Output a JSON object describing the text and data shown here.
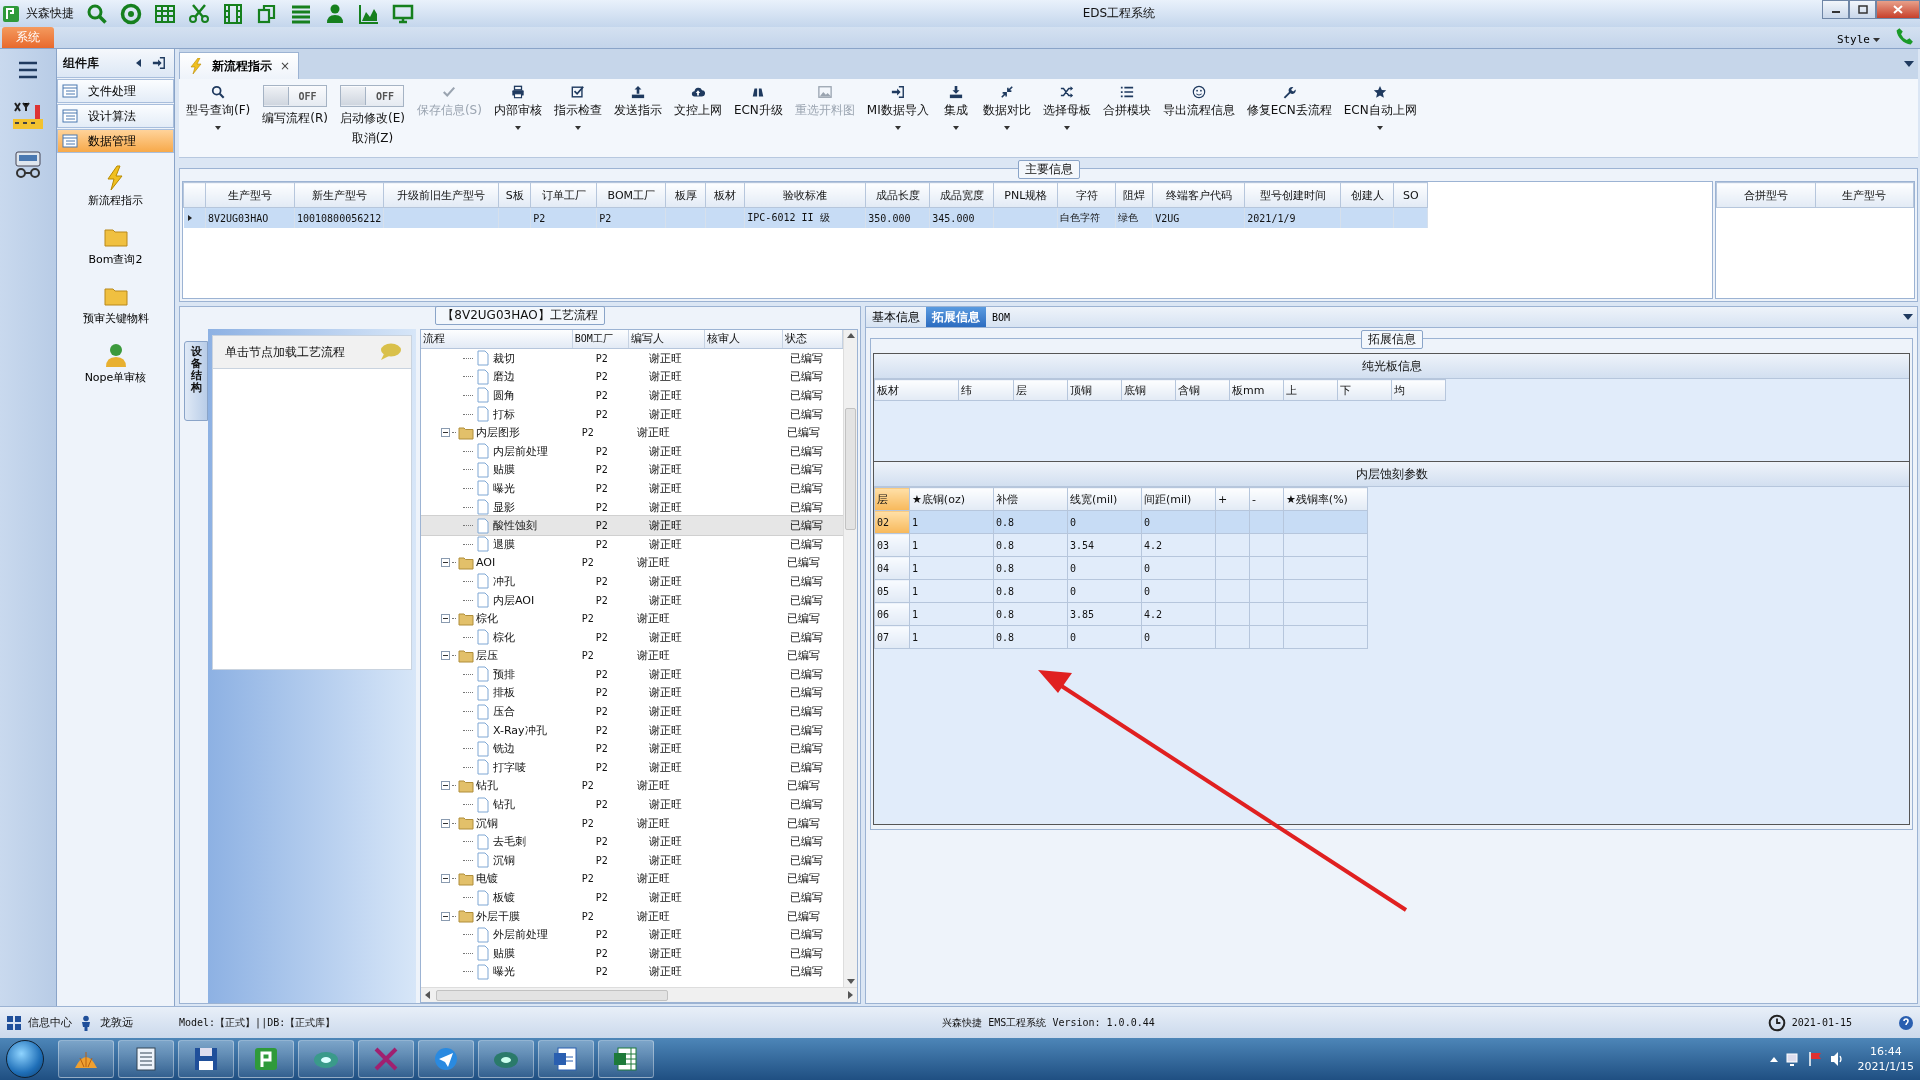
{
  "window": {
    "app_name": "兴森快捷",
    "title": "EDS工程系统"
  },
  "ribbon": {
    "tab": "系统",
    "style_menu": "Style"
  },
  "component_panel": {
    "title": "组件库",
    "items": [
      {
        "label": "文件处理",
        "selected": false
      },
      {
        "label": "设计算法",
        "selected": false
      },
      {
        "label": "数据管理",
        "selected": true
      }
    ],
    "shortcuts": [
      "新流程指示",
      "Bom查询2",
      "预审关键物料",
      "Nope单审核"
    ]
  },
  "document_tab": {
    "title": "新流程指示",
    "close": "×"
  },
  "toolbar": [
    {
      "kind": "button",
      "label": "型号查询(F)",
      "disabled": false,
      "dropdown": true
    },
    {
      "kind": "toggle",
      "label": "编写流程(R)",
      "toggle_text": "OFF",
      "on": false,
      "disabled": false,
      "dropdown": false
    },
    {
      "kind": "toggle",
      "label": "启动修改(E)",
      "sub_label": "取消(Z)",
      "toggle_text": "OFF",
      "on": false,
      "disabled": false,
      "dropdown": false
    },
    {
      "kind": "button",
      "label": "保存信息(S)",
      "disabled": true,
      "dropdown": false
    },
    {
      "kind": "button",
      "label": "内部审核",
      "disabled": false,
      "dropdown": true
    },
    {
      "kind": "button",
      "label": "指示检查",
      "disabled": false,
      "dropdown": true
    },
    {
      "kind": "button",
      "label": "发送指示",
      "disabled": false,
      "dropdown": false
    },
    {
      "kind": "button",
      "label": "文控上网",
      "disabled": false,
      "dropdown": false
    },
    {
      "kind": "button",
      "label": "ECN升级",
      "disabled": false,
      "dropdown": false
    },
    {
      "kind": "button",
      "label": "重选开料图",
      "disabled": true,
      "dropdown": false
    },
    {
      "kind": "button",
      "label": "MI数据导入",
      "disabled": false,
      "dropdown": true
    },
    {
      "kind": "button",
      "label": "集成",
      "disabled": false,
      "dropdown": true
    },
    {
      "kind": "button",
      "label": "数据对比",
      "disabled": false,
      "dropdown": true
    },
    {
      "kind": "button",
      "label": "选择母板",
      "disabled": false,
      "dropdown": true
    },
    {
      "kind": "button",
      "label": "合拼模块",
      "disabled": false,
      "dropdown": false
    },
    {
      "kind": "button",
      "label": "导出流程信息",
      "disabled": false,
      "dropdown": false
    },
    {
      "kind": "button",
      "label": "修复ECN丢流程",
      "disabled": false,
      "dropdown": false
    },
    {
      "kind": "button",
      "label": "ECN自动上网",
      "disabled": false,
      "dropdown": true
    }
  ],
  "main_info": {
    "title": "主要信息",
    "columns": [
      "生产型号",
      "新生产型号",
      "升级前旧生产型号",
      "S板",
      "订单工厂",
      "BOM工厂",
      "板厚",
      "板材",
      "验收标准",
      "成品长度",
      "成品宽度",
      "PNL规格",
      "字符",
      "阻焊",
      "终端客户代码",
      "型号创建时间",
      "创建人",
      "SO"
    ],
    "rows": [
      {
        "selected": true,
        "cells": [
          "8V2UG03HAO",
          "10010800056212",
          null,
          null,
          "P2",
          "P2",
          null,
          null,
          "IPC-6012 II 级",
          "350.000",
          "345.000",
          null,
          "白色字符",
          "绿色",
          "V2UG",
          "2021/1/9",
          null,
          null
        ]
      }
    ],
    "merge_columns": [
      "合拼型号",
      "生产型号"
    ]
  },
  "process_tree": {
    "title": "【8V2UG03HAO】工艺流程",
    "side_tab": "设备结构",
    "hint": "单击节点加载工艺流程",
    "columns": [
      "流程",
      "BOM工厂",
      "编写人",
      "核审人",
      "状态"
    ],
    "nodes": [
      {
        "kind": "step",
        "name": "裁切",
        "bom": "P2",
        "author": "谢正旺",
        "status": "已编写",
        "selected": false
      },
      {
        "kind": "step",
        "name": "磨边",
        "bom": "P2",
        "author": "谢正旺",
        "status": "已编写",
        "selected": false
      },
      {
        "kind": "step",
        "name": "圆角",
        "bom": "P2",
        "author": "谢正旺",
        "status": "已编写",
        "selected": false
      },
      {
        "kind": "step",
        "name": "打标",
        "bom": "P2",
        "author": "谢正旺",
        "status": "已编写",
        "selected": false
      },
      {
        "kind": "folder",
        "name": "内层图形",
        "bom": "P2",
        "author": "谢正旺",
        "status": "已编写",
        "selected": false,
        "expanded": true,
        "children": [
          {
            "kind": "step",
            "name": "内层前处理",
            "bom": "P2",
            "author": "谢正旺",
            "status": "已编写",
            "selected": false
          },
          {
            "kind": "step",
            "name": "贴膜",
            "bom": "P2",
            "author": "谢正旺",
            "status": "已编写",
            "selected": false
          },
          {
            "kind": "step",
            "name": "曝光",
            "bom": "P2",
            "author": "谢正旺",
            "status": "已编写",
            "selected": false
          },
          {
            "kind": "step",
            "name": "显影",
            "bom": "P2",
            "author": "谢正旺",
            "status": "已编写",
            "selected": false
          },
          {
            "kind": "step",
            "name": "酸性蚀刻",
            "bom": "P2",
            "author": "谢正旺",
            "status": "已编写",
            "selected": true
          },
          {
            "kind": "step",
            "name": "退膜",
            "bom": "P2",
            "author": "谢正旺",
            "status": "已编写",
            "selected": false
          }
        ]
      },
      {
        "kind": "folder",
        "name": "AOI",
        "bom": "P2",
        "author": "谢正旺",
        "status": "已编写",
        "selected": false,
        "expanded": true,
        "children": [
          {
            "kind": "step",
            "name": "冲孔",
            "bom": "P2",
            "author": "谢正旺",
            "status": "已编写",
            "selected": false
          },
          {
            "kind": "step",
            "name": "内层AOI",
            "bom": "P2",
            "author": "谢正旺",
            "status": "已编写",
            "selected": false
          }
        ]
      },
      {
        "kind": "folder",
        "name": "棕化",
        "bom": "P2",
        "author": "谢正旺",
        "status": "已编写",
        "selected": false,
        "expanded": true,
        "children": [
          {
            "kind": "step",
            "name": "棕化",
            "bom": "P2",
            "author": "谢正旺",
            "status": "已编写",
            "selected": false
          }
        ]
      },
      {
        "kind": "folder",
        "name": "层压",
        "bom": "P2",
        "author": "谢正旺",
        "status": "已编写",
        "selected": false,
        "expanded": true,
        "children": [
          {
            "kind": "step",
            "name": "预排",
            "bom": "P2",
            "author": "谢正旺",
            "status": "已编写",
            "selected": false
          },
          {
            "kind": "step",
            "name": "排板",
            "bom": "P2",
            "author": "谢正旺",
            "status": "已编写",
            "selected": false
          },
          {
            "kind": "step",
            "name": "压合",
            "bom": "P2",
            "author": "谢正旺",
            "status": "已编写",
            "selected": false
          },
          {
            "kind": "step",
            "name": "X-Ray冲孔",
            "bom": "P2",
            "author": "谢正旺",
            "status": "已编写",
            "selected": false
          },
          {
            "kind": "step",
            "name": "铣边",
            "bom": "P2",
            "author": "谢正旺",
            "status": "已编写",
            "selected": false
          },
          {
            "kind": "step",
            "name": "打字唛",
            "bom": "P2",
            "author": "谢正旺",
            "status": "已编写",
            "selected": false
          }
        ]
      },
      {
        "kind": "folder",
        "name": "钻孔",
        "bom": "P2",
        "author": "谢正旺",
        "status": "已编写",
        "selected": false,
        "expanded": true,
        "children": [
          {
            "kind": "step",
            "name": "钻孔",
            "bom": "P2",
            "author": "谢正旺",
            "status": "已编写",
            "selected": false
          }
        ]
      },
      {
        "kind": "folder",
        "name": "沉铜",
        "bom": "P2",
        "author": "谢正旺",
        "status": "已编写",
        "selected": false,
        "expanded": true,
        "children": [
          {
            "kind": "step",
            "name": "去毛刺",
            "bom": "P2",
            "author": "谢正旺",
            "status": "已编写",
            "selected": false
          },
          {
            "kind": "step",
            "name": "沉铜",
            "bom": "P2",
            "author": "谢正旺",
            "status": "已编写",
            "selected": false
          }
        ]
      },
      {
        "kind": "folder",
        "name": "电镀",
        "bom": "P2",
        "author": "谢正旺",
        "status": "已编写",
        "selected": false,
        "expanded": true,
        "children": [
          {
            "kind": "step",
            "name": "板镀",
            "bom": "P2",
            "author": "谢正旺",
            "status": "已编写",
            "selected": false
          }
        ]
      },
      {
        "kind": "folder",
        "name": "外层干膜",
        "bom": "P2",
        "author": "谢正旺",
        "status": "已编写",
        "selected": false,
        "expanded": true,
        "children": [
          {
            "kind": "step",
            "name": "外层前处理",
            "bom": "P2",
            "author": "谢正旺",
            "status": "已编写",
            "selected": false
          },
          {
            "kind": "step",
            "name": "贴膜",
            "bom": "P2",
            "author": "谢正旺",
            "status": "已编写",
            "selected": false
          },
          {
            "kind": "step",
            "name": "曝光",
            "bom": "P2",
            "author": "谢正旺",
            "status": "已编写",
            "selected": false
          }
        ]
      }
    ]
  },
  "detail_tabs": [
    {
      "label": "基本信息",
      "selected": false
    },
    {
      "label": "拓展信息",
      "selected": true
    },
    {
      "label": "BOM",
      "selected": false
    }
  ],
  "extended_info": {
    "title": "拓展信息",
    "bare_board": {
      "title": "纯光板信息",
      "columns": [
        "板材",
        "纬",
        "层",
        "顶铜",
        "底铜",
        "含铜",
        "板mm",
        "上",
        "下",
        "均"
      ]
    },
    "inner_etch": {
      "title": "内层蚀刻参数",
      "columns": [
        "层",
        "★底铜(oz)",
        "补偿",
        "线宽(mil)",
        "间距(mil)",
        "+",
        "-",
        "★残铜率(%)"
      ],
      "rows": [
        {
          "selected": true,
          "cells": [
            "02",
            "1",
            "0.8",
            "0",
            "0",
            null,
            null,
            null
          ]
        },
        {
          "selected": false,
          "cells": [
            "03",
            "1",
            "0.8",
            "3.54",
            "4.2",
            null,
            null,
            null
          ]
        },
        {
          "selected": false,
          "cells": [
            "04",
            "1",
            "0.8",
            "0",
            "0",
            null,
            null,
            null
          ]
        },
        {
          "selected": false,
          "cells": [
            "05",
            "1",
            "0.8",
            "0",
            "0",
            null,
            null,
            null
          ]
        },
        {
          "selected": false,
          "cells": [
            "06",
            "1",
            "0.8",
            "3.85",
            "4.2",
            null,
            null,
            null
          ]
        },
        {
          "selected": false,
          "cells": [
            "07",
            "1",
            "0.8",
            "0",
            "0",
            null,
            null,
            null
          ]
        }
      ]
    }
  },
  "status_bar": {
    "info_center": "信息中心",
    "user": "龙敦远",
    "model": "Model:【正式】||DB:【正式库】",
    "app": "兴森快捷 EMS工程系统 Version: 1.0.0.44",
    "date": "2021-01-15"
  },
  "taskbar": {
    "time": "16:44",
    "date": "2021/1/15"
  }
}
